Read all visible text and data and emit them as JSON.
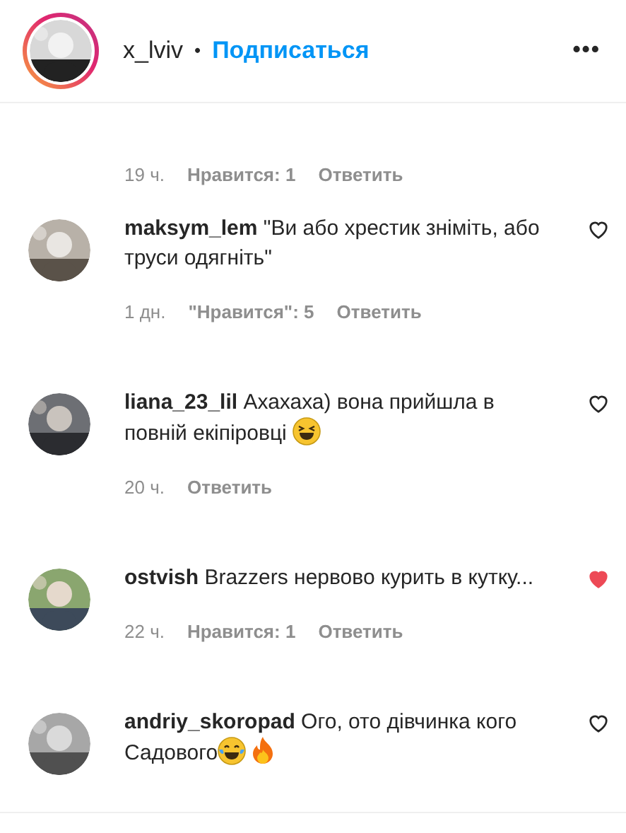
{
  "header": {
    "username": "x_lviv",
    "separator": "•",
    "follow": "Подписаться",
    "menu": "•••"
  },
  "comments": [
    {
      "time": "19 ч.",
      "likes": "Нравится: 1",
      "reply": "Ответить",
      "kind": "cut"
    },
    {
      "username": "maksym_lem",
      "text": "\"Ви або хрестик зніміть, або труси одягніть\"",
      "liked": false,
      "time": "1 дн.",
      "likes": "\"Нравится\": 5",
      "reply": "Ответить",
      "kind": "full"
    },
    {
      "username": "liana_23_lil",
      "text": "Ахахаха) вона прийшла в повній екіпіровці",
      "emojis": [
        {
          "kind": "squint"
        }
      ],
      "liked": false,
      "time": "20 ч.",
      "reply": "Ответить",
      "kind": "full"
    },
    {
      "username": "ostvish",
      "text": "Brazzers нервово курить в кутку...",
      "liked": true,
      "time": "22 ч.",
      "likes": "Нравится: 1",
      "reply": "Ответить",
      "kind": "full"
    },
    {
      "username": "andriy_skoropad",
      "text": "Ого, ото дівчинка кого Садового",
      "emojis": [
        {
          "kind": "tears"
        },
        {
          "kind": "fire"
        }
      ],
      "liked": false,
      "kind": "full"
    }
  ]
}
